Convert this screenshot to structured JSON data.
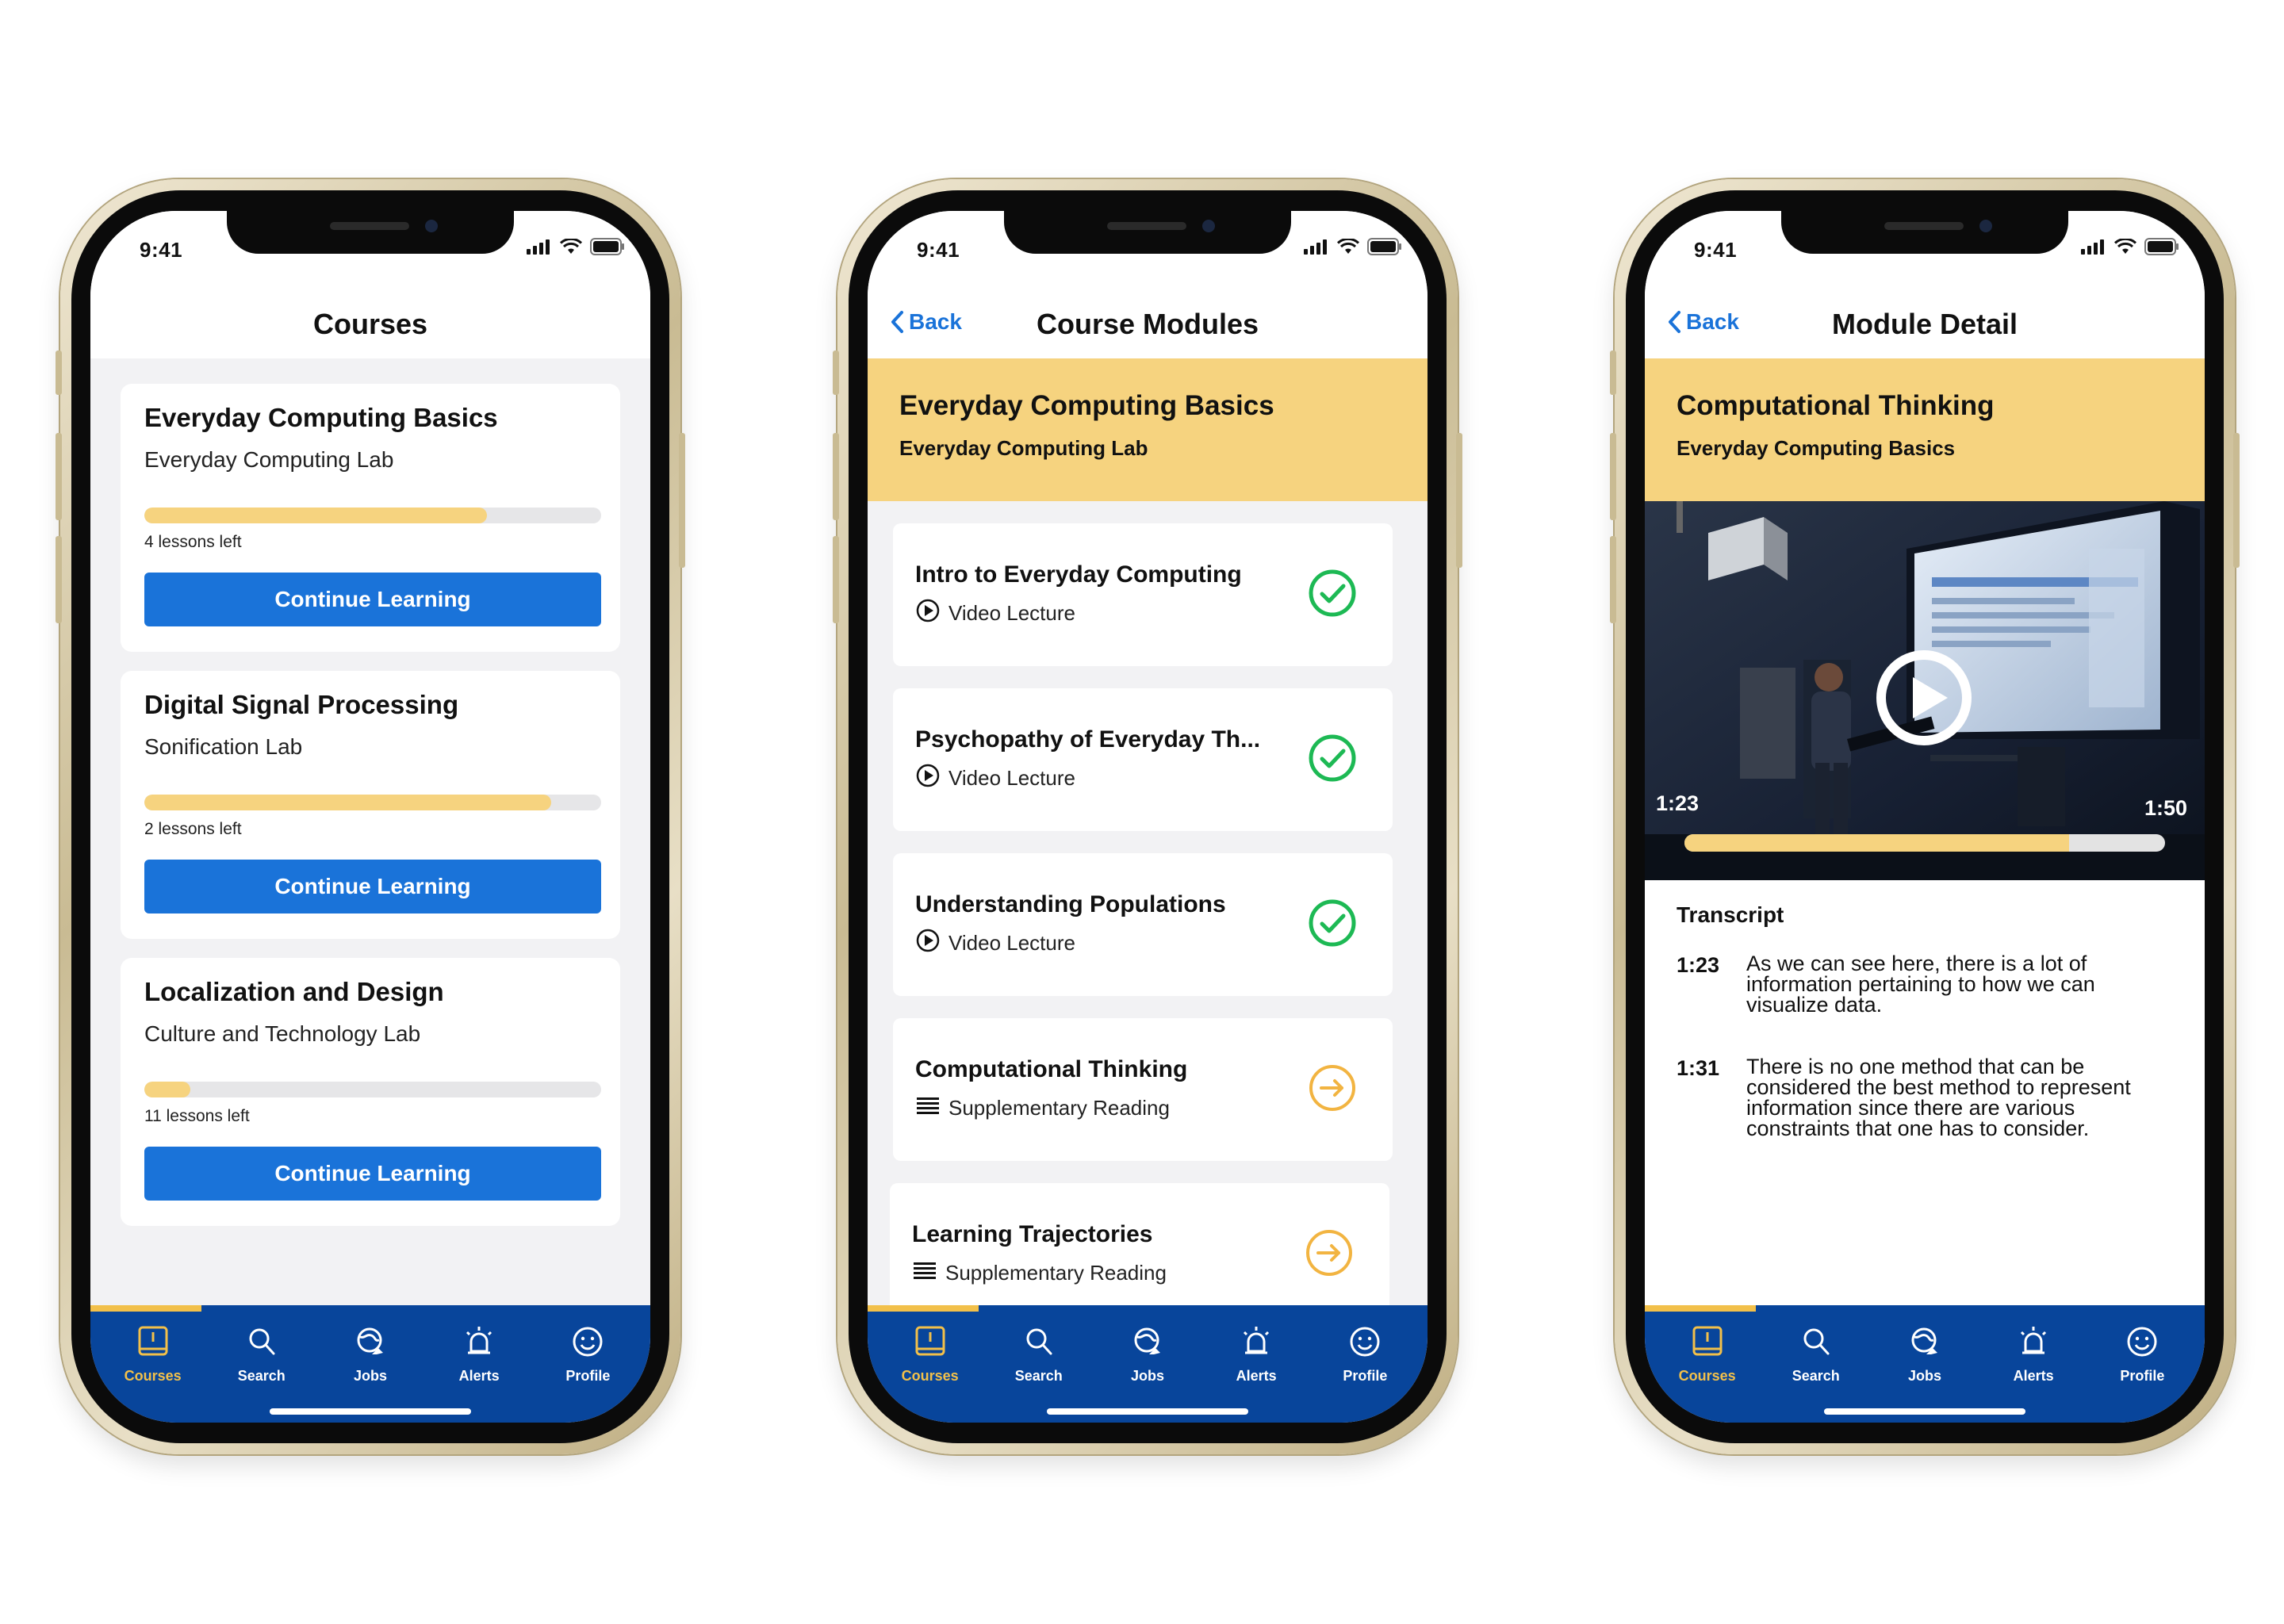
{
  "status": {
    "time": "9:41"
  },
  "colors": {
    "accent": "#1a73d9",
    "highlight": "#f6d37f",
    "tabbar": "#08459b",
    "complete": "#1db954",
    "pending": "#f2b441"
  },
  "icons": {
    "signal": "signal-icon",
    "wifi": "wifi-icon",
    "battery": "battery-icon"
  },
  "tabs": [
    {
      "label": "Courses",
      "icon": "courses-icon",
      "active": true
    },
    {
      "label": "Search",
      "icon": "search-icon",
      "active": false
    },
    {
      "label": "Jobs",
      "icon": "jobs-icon",
      "active": false
    },
    {
      "label": "Alerts",
      "icon": "alerts-icon",
      "active": false
    },
    {
      "label": "Profile",
      "icon": "profile-icon",
      "active": false
    }
  ],
  "screen1": {
    "title": "Courses",
    "courses": [
      {
        "title": "Everyday Computing Basics",
        "lab": "Everyday Computing Lab",
        "progress_pct": 75,
        "lessons_left": "4 lessons left",
        "cta": "Continue Learning"
      },
      {
        "title": "Digital Signal Processing",
        "lab": "Sonification Lab",
        "progress_pct": 89,
        "lessons_left": "2 lessons left",
        "cta": "Continue Learning"
      },
      {
        "title": "Localization and Design",
        "lab": "Culture and Technology Lab",
        "progress_pct": 10,
        "lessons_left": "11 lessons left",
        "cta": "Continue Learning"
      }
    ]
  },
  "screen2": {
    "back": "Back",
    "title": "Course Modules",
    "hero_title": "Everyday Computing Basics",
    "hero_sub": "Everyday Computing Lab",
    "modules": [
      {
        "title": "Intro to Everyday Computing",
        "type": "Video Lecture",
        "type_icon": "play-circle-icon",
        "status": "complete"
      },
      {
        "title": "Psychopathy of Everyday Th...",
        "type": "Video Lecture",
        "type_icon": "play-circle-icon",
        "status": "complete"
      },
      {
        "title": "Understanding Populations",
        "type": "Video Lecture",
        "type_icon": "play-circle-icon",
        "status": "complete"
      },
      {
        "title": "Computational Thinking",
        "type": "Supplementary Reading",
        "type_icon": "reading-lines-icon",
        "status": "pending"
      },
      {
        "title": "Learning Trajectories",
        "type": "Supplementary Reading",
        "type_icon": "reading-lines-icon",
        "status": "pending"
      }
    ]
  },
  "screen3": {
    "back": "Back",
    "title": "Module Detail",
    "hero_title": "Computational Thinking",
    "hero_sub": "Everyday Computing Basics",
    "video": {
      "current": "1:23",
      "total": "1:50",
      "progress_pct": 80
    },
    "transcript_title": "Transcript",
    "transcript": [
      {
        "time": "1:23",
        "text": "As we can see here, there is a lot of information pertaining to how we can visualize data."
      },
      {
        "time": "1:31",
        "text": "There is no one method that can be considered the best method to represent information since there are various constraints that one has to consider."
      }
    ]
  }
}
